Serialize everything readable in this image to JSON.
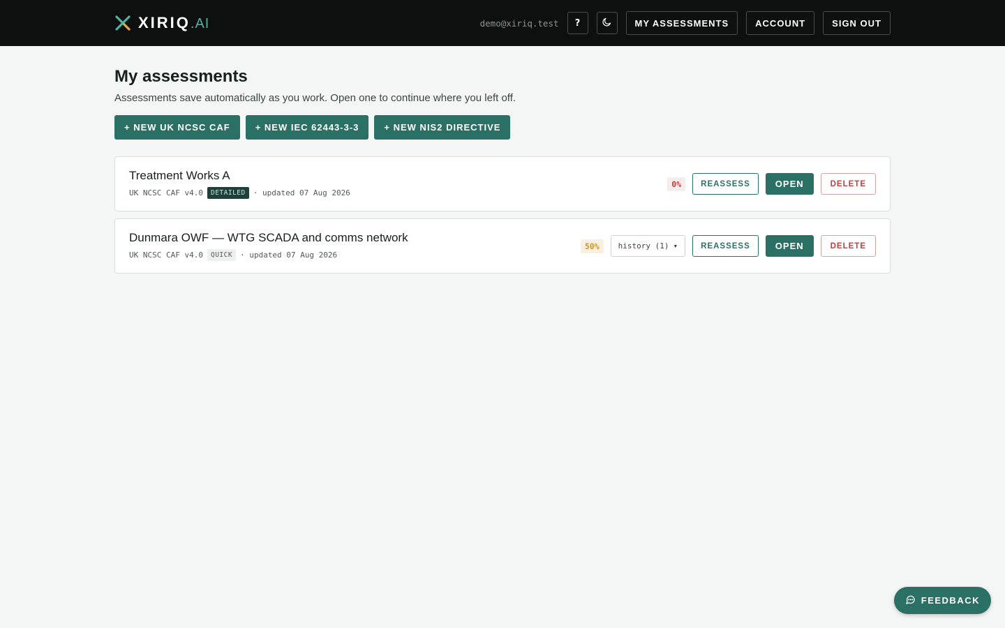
{
  "brand": {
    "name": "XIRIQ",
    "suffix": ".AI"
  },
  "header": {
    "user_email": "demo@xiriq.test",
    "help_label": "?",
    "theme_icon": "moon-icon",
    "nav": {
      "my_assessments": "MY ASSESSMENTS",
      "account": "ACCOUNT",
      "sign_out": "SIGN OUT"
    }
  },
  "page": {
    "title": "My assessments",
    "subtitle": "Assessments save automatically as you work. Open one to continue where you left off."
  },
  "actions": [
    {
      "label": "+ NEW UK NCSC CAF"
    },
    {
      "label": "+ NEW IEC 62443-3-3"
    },
    {
      "label": "+ NEW NIS2 DIRECTIVE"
    }
  ],
  "assessments": [
    {
      "title": "Treatment Works A",
      "framework": "UK NCSC CAF v4.0",
      "mode": "DETAILED",
      "updated": "· updated 07 Aug 2026",
      "progress": "0%",
      "reassess": "REASSESS",
      "open": "OPEN",
      "delete": "DELETE"
    },
    {
      "title": "Dunmara OWF — WTG SCADA and comms network",
      "framework": "UK NCSC CAF v4.0",
      "mode": "QUICK",
      "updated": "· updated 07 Aug 2026",
      "progress": "50%",
      "history": "history (1)",
      "reassess": "REASSESS",
      "open": "OPEN",
      "delete": "DELETE"
    }
  ],
  "feedback": {
    "label": "FEEDBACK",
    "icon": "chat-bubble-icon"
  },
  "colors": {
    "accent": "#2b7064",
    "header_bg": "#0e0f0f",
    "page_bg": "#f4f6f5",
    "danger": "#c73c3c",
    "warning": "#d9921b"
  }
}
